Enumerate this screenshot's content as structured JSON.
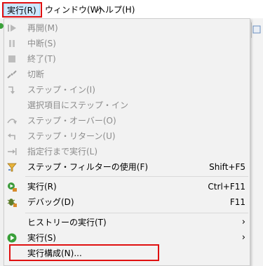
{
  "menubar": {
    "items": [
      {
        "label": "実行(R)"
      },
      {
        "label": "ウィンドウ(W)"
      },
      {
        "label": "ヘルプ(H)"
      }
    ]
  },
  "menu": {
    "items": [
      {
        "label": "再開(M)",
        "shortcut": "",
        "enabled": false,
        "icon": "resume-icon"
      },
      {
        "label": "中断(S)",
        "shortcut": "",
        "enabled": false,
        "icon": "suspend-icon"
      },
      {
        "label": "終了(T)",
        "shortcut": "",
        "enabled": false,
        "icon": "terminate-icon"
      },
      {
        "label": "切断",
        "shortcut": "",
        "enabled": false,
        "icon": "disconnect-icon"
      },
      {
        "label": "ステップ・イン(I)",
        "shortcut": "",
        "enabled": false,
        "icon": "step-into-icon"
      },
      {
        "label": "選択項目にステップ・イン",
        "shortcut": "",
        "enabled": false,
        "icon": ""
      },
      {
        "label": "ステップ・オーバー(O)",
        "shortcut": "",
        "enabled": false,
        "icon": "step-over-icon"
      },
      {
        "label": "ステップ・リターン(U)",
        "shortcut": "",
        "enabled": false,
        "icon": "step-return-icon"
      },
      {
        "label": "指定行まで実行(L)",
        "shortcut": "",
        "enabled": false,
        "icon": "run-to-line-icon"
      },
      {
        "label": "ステップ・フィルターの使用(F)",
        "shortcut": "Shift+F5",
        "enabled": true,
        "icon": "step-filter-icon"
      },
      {
        "label": "実行(R)",
        "shortcut": "Ctrl+F11",
        "enabled": true,
        "icon": "run-icon"
      },
      {
        "label": "デバッグ(D)",
        "shortcut": "F11",
        "enabled": true,
        "icon": "debug-icon"
      },
      {
        "label": "ヒストリーの実行(T)",
        "shortcut": "",
        "enabled": true,
        "icon": "",
        "submenu": true
      },
      {
        "label": "実行(S)",
        "shortcut": "",
        "enabled": true,
        "icon": "run-as-icon",
        "submenu": true
      },
      {
        "label": "実行構成(N)...",
        "shortcut": "",
        "enabled": true,
        "icon": ""
      }
    ]
  },
  "colors": {
    "highlight_box": "#e01010",
    "menu_bg": "#f2f2f2",
    "disabled_text": "#8c8c8c"
  }
}
